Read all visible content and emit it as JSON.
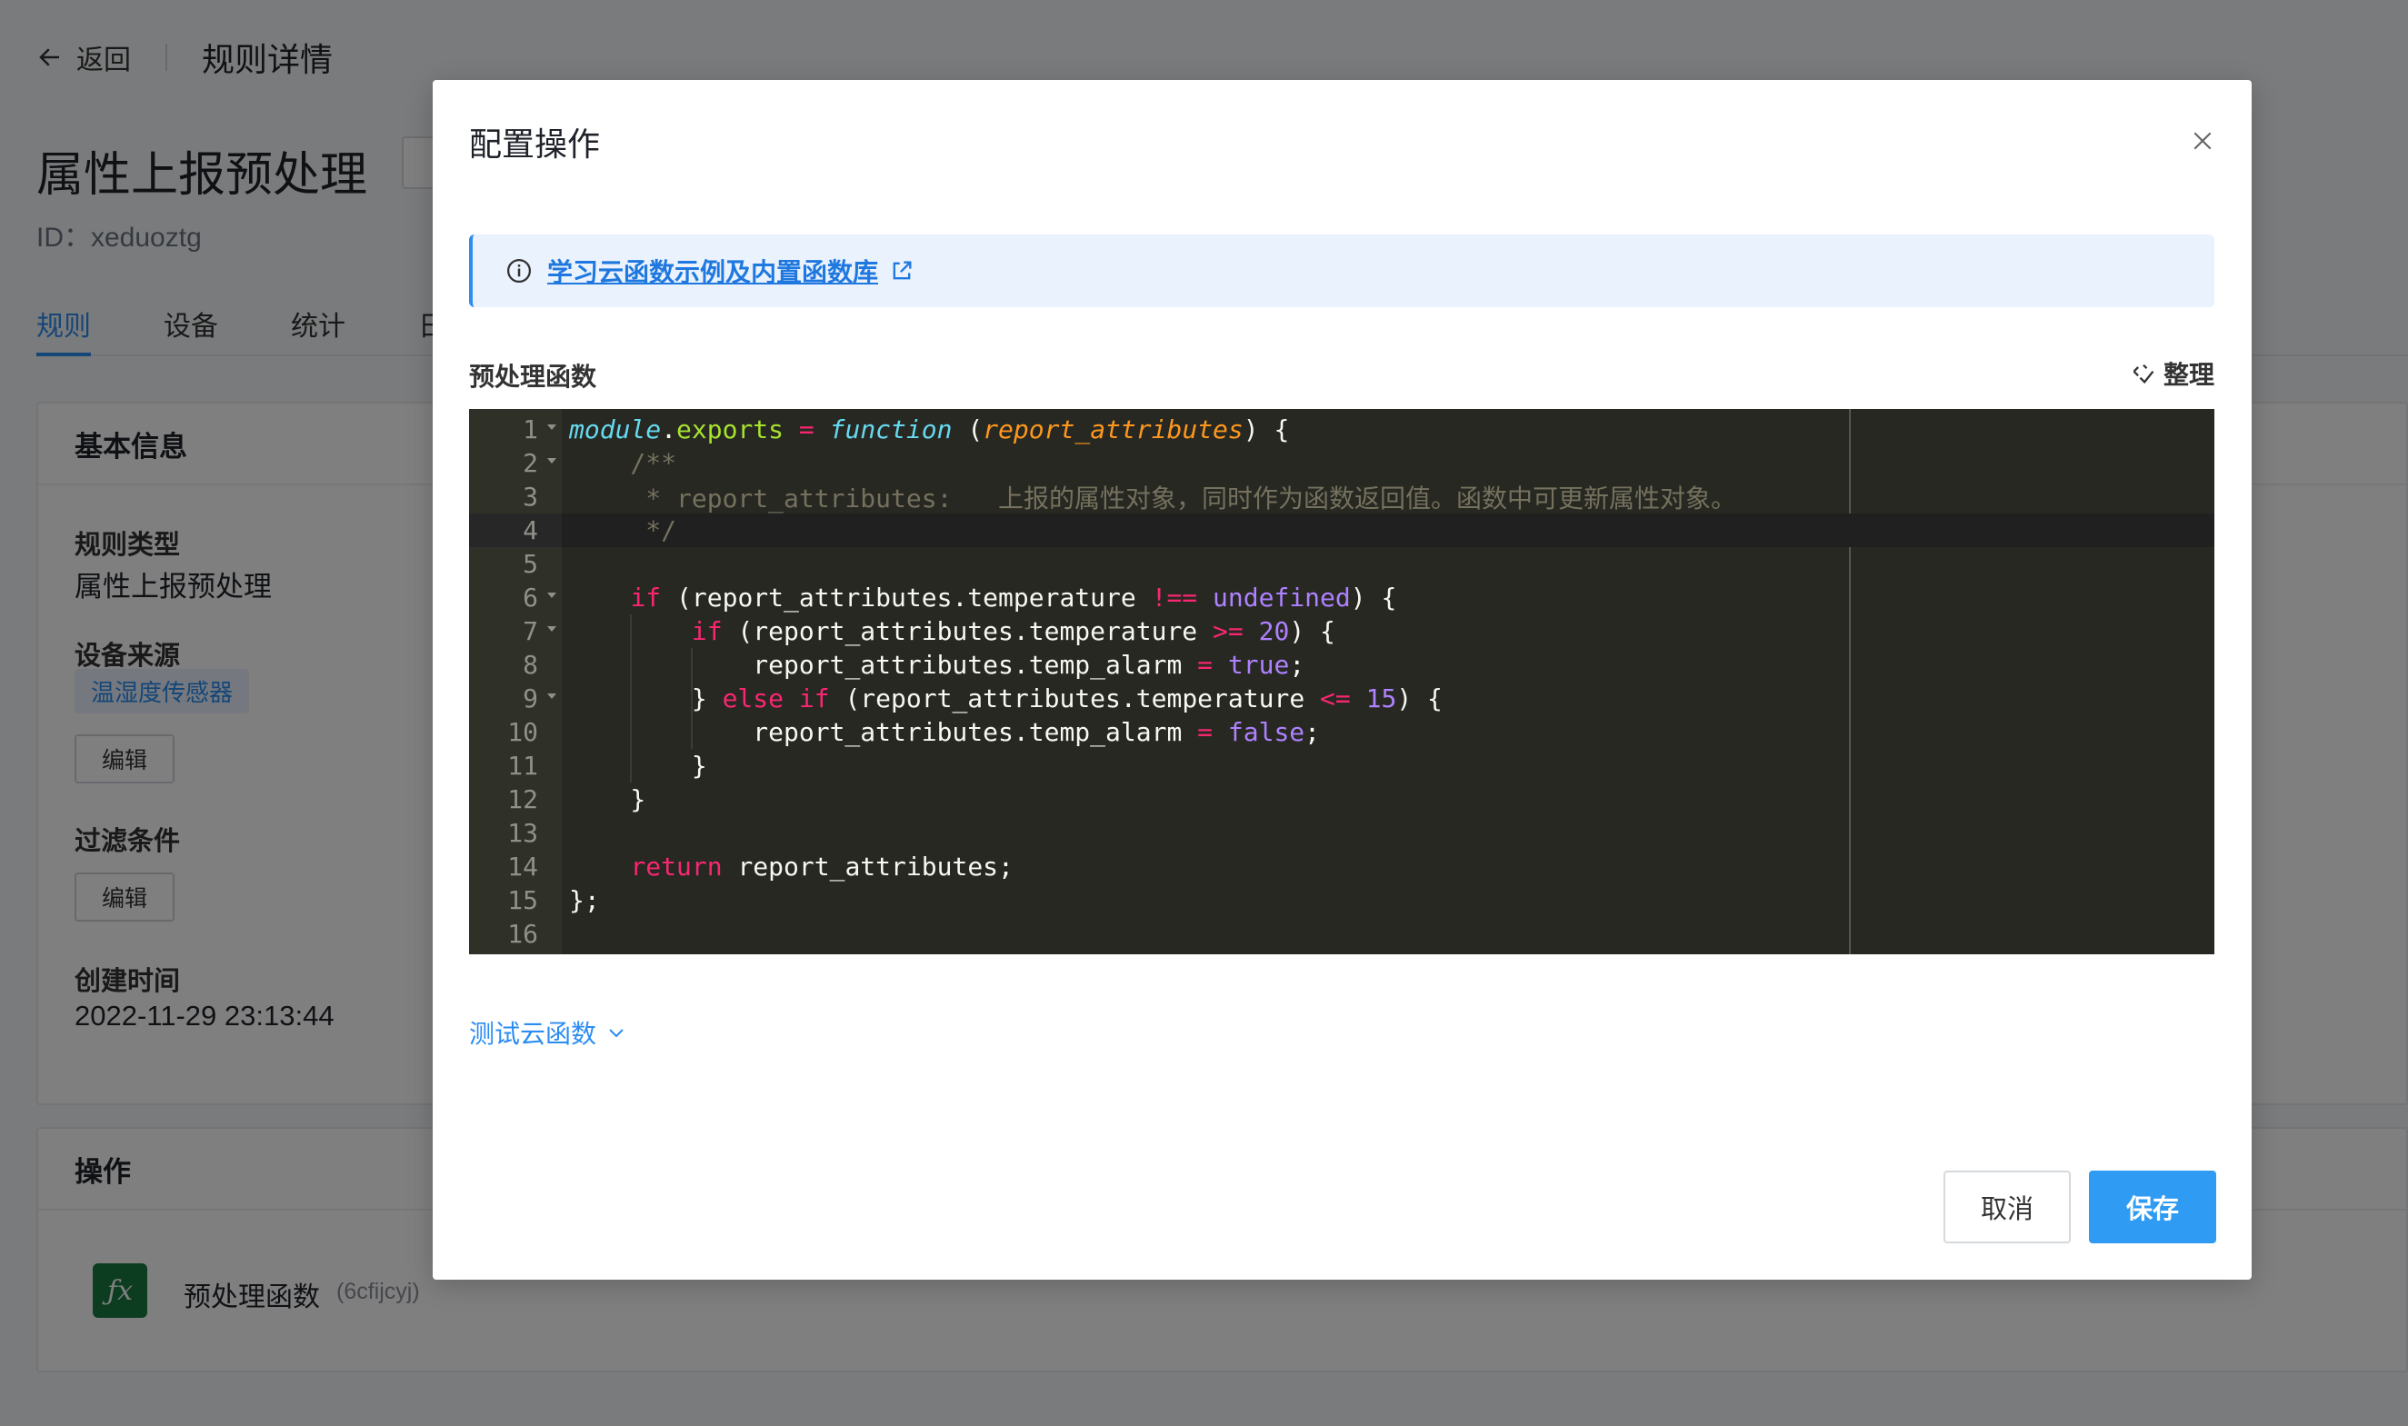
{
  "header": {
    "back_label": "返回",
    "page_title": "规则详情"
  },
  "rule": {
    "name": "属性上报预处理",
    "id_text": "ID：xeduoztg"
  },
  "tabs": [
    {
      "label": "规则"
    },
    {
      "label": "设备"
    },
    {
      "label": "统计"
    },
    {
      "label": "日"
    }
  ],
  "basic_info": {
    "title": "基本信息",
    "rule_type_label": "规则类型",
    "rule_type_value": "属性上报预处理",
    "device_source_label": "设备来源",
    "device_source_tag": "温湿度传感器",
    "edit_label": "编辑",
    "filter_label": "过滤条件",
    "created_label": "创建时间",
    "created_value": "2022-11-29 23:13:44"
  },
  "operations": {
    "title": "操作",
    "item_name": "预处理函数",
    "item_id": "(6cfijcyj)"
  },
  "modal": {
    "title": "配置操作",
    "info_link": "学习云函数示例及内置函数库",
    "section_label": "预处理函数",
    "format_label": "整理",
    "test_label": "测试云函数",
    "cancel_label": "取消",
    "save_label": "保存",
    "active_line": 4
  },
  "code": [
    "module.exports = function (report_attributes) {",
    "    /**",
    "     * report_attributes:   上报的属性对象，同时作为函数返回值。函数中可更新属性对象。",
    "     */",
    "",
    "    if (report_attributes.temperature !== undefined) {",
    "        if (report_attributes.temperature >= 20) {",
    "            report_attributes.temp_alarm = true;",
    "        } else if (report_attributes.temperature <= 15) {",
    "            report_attributes.temp_alarm = false;",
    "        }",
    "    }",
    "",
    "    return report_attributes;",
    "};",
    ""
  ],
  "colors": {
    "accent": "#2b8cf1",
    "editor_bg": "#272822",
    "save_bg": "#2f9bf3"
  }
}
